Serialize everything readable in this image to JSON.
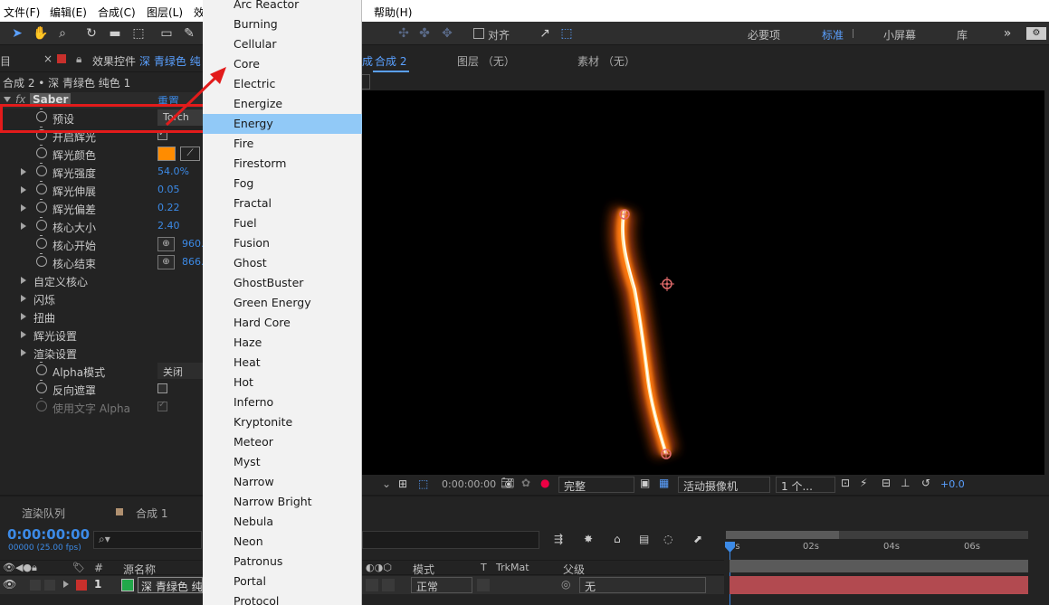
{
  "menubar": {
    "file": "文件(F)",
    "edit": "编辑(E)",
    "composition": "合成(C)",
    "layer": "图层(L)",
    "effect": "效",
    "help": "帮助(H)"
  },
  "toolbar": {
    "align_label": "对齐",
    "workspaces": [
      "必要项",
      "标准",
      "小屏幕",
      "库"
    ],
    "active_workspace": "标准"
  },
  "left_panel": {
    "tab_effect_controls": "效果控件",
    "tab_layer_name": "深 青绿色 纯",
    "breadcrumb": "合成 2 • 深 青绿色 纯色 1",
    "effect_name": "Saber",
    "reset_label": "重置",
    "properties": [
      {
        "label": "预设",
        "value": "Torch"
      },
      {
        "label": "开启辉光",
        "value": ""
      },
      {
        "label": "辉光颜色",
        "value": ""
      },
      {
        "label": "辉光强度",
        "value": "54.0%"
      },
      {
        "label": "辉光伸展",
        "value": "0.05"
      },
      {
        "label": "辉光偏差",
        "value": "0.22"
      },
      {
        "label": "核心大小",
        "value": "2.40"
      },
      {
        "label": "核心开始",
        "value": "960."
      },
      {
        "label": "核心结束",
        "value": "866."
      },
      {
        "label": "自定义核心",
        "value": ""
      },
      {
        "label": "闪烁",
        "value": ""
      },
      {
        "label": "扭曲",
        "value": ""
      },
      {
        "label": "辉光设置",
        "value": ""
      },
      {
        "label": "渲染设置",
        "value": ""
      },
      {
        "label": "Alpha模式",
        "value": "关闭"
      },
      {
        "label": "反向遮罩",
        "value": ""
      },
      {
        "label": "使用文字 Alpha",
        "value": ""
      }
    ],
    "glow_color": "#ff8c00"
  },
  "dropdown": {
    "items": [
      "Arc Reactor",
      "Burning",
      "Cellular",
      "Core",
      "Electric",
      "Energize",
      "Energy",
      "Fire",
      "Firestorm",
      "Fog",
      "Fractal",
      "Fuel",
      "Fusion",
      "Ghost",
      "GhostBuster",
      "Green Energy",
      "Hard Core",
      "Haze",
      "Heat",
      "Hot",
      "Inferno",
      "Kryptonite",
      "Meteor",
      "Myst",
      "Narrow",
      "Narrow Bright",
      "Nebula",
      "Neon",
      "Patronus",
      "Portal",
      "Protocol"
    ],
    "selected": "Energy"
  },
  "viewer": {
    "tab_comp": "合成 2",
    "tab_comp_prefix": "成",
    "tab_layer": "图层 （无）",
    "tab_footage": "素材 （无）",
    "timecode": "0:00:00:00",
    "resolution": "完整",
    "camera": "活动摄像机",
    "views": "1 个...",
    "exposure": "+0.0"
  },
  "timeline": {
    "tab_render_queue": "渲染队列",
    "tab_comp1": "合成 1",
    "timecode": "0:00:00:00",
    "frame_info": "00000 (25.00 fps)",
    "col_hash": "#",
    "col_source": "源名称",
    "col_mode": "模式",
    "col_t": "T",
    "col_trkmat": "TrkMat",
    "col_parent": "父级",
    "layer_index": "1",
    "layer_name": "深 青绿色 纯",
    "layer_mode": "正常",
    "layer_parent": "无",
    "ruler": [
      "0s",
      "02s",
      "04s",
      "06s"
    ]
  }
}
